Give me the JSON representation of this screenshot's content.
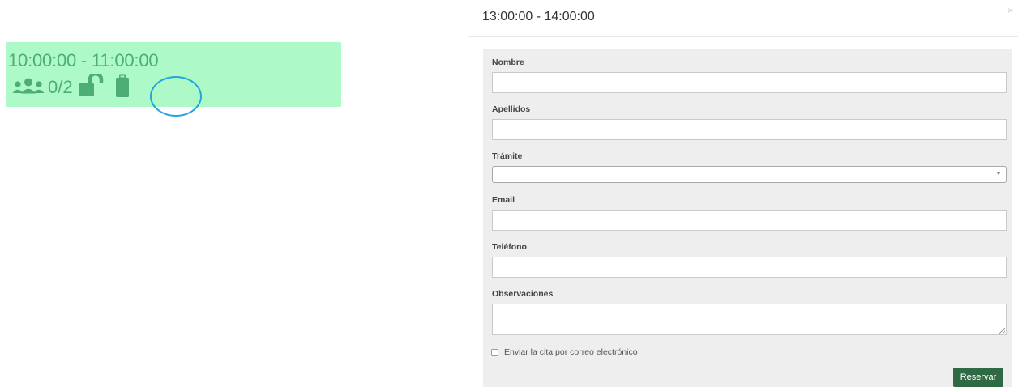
{
  "slot": {
    "time_range": "10:00:00 - 11:00:00",
    "occupancy": "0/2",
    "icons": [
      "users-icon",
      "unlock-icon",
      "clipboard-icon"
    ],
    "background_color": "#adfac8",
    "text_color": "#4cae72",
    "highlight_color": "#1fa6e0"
  },
  "modal": {
    "title": "13:00:00 - 14:00:00",
    "close_label": "×",
    "fields": {
      "nombre": {
        "label": "Nombre",
        "value": ""
      },
      "apellidos": {
        "label": "Apellidos",
        "value": ""
      },
      "tramite": {
        "label": "Trámite",
        "selected": ""
      },
      "email": {
        "label": "Email",
        "value": ""
      },
      "telefono": {
        "label": "Teléfono",
        "value": ""
      },
      "observaciones": {
        "label": "Observaciones",
        "value": ""
      }
    },
    "send_email_checkbox": {
      "label": "Enviar la cita por correo electrónico",
      "checked": false
    },
    "submit_label": "Reservar",
    "submit_color": "#2e6a43",
    "panel_color": "#eeeeee"
  }
}
